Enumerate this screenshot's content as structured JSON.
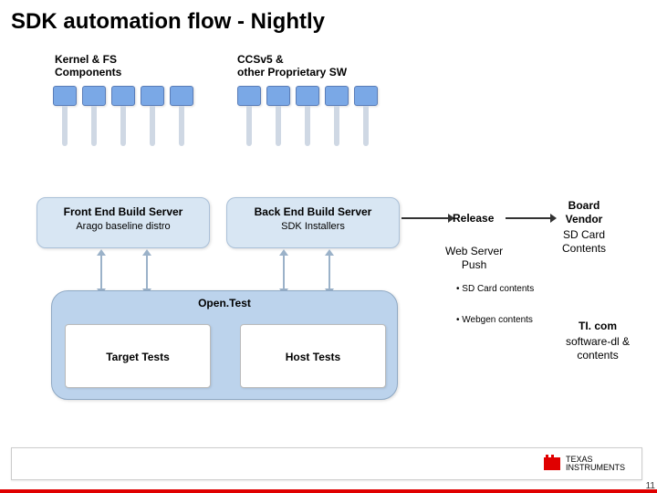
{
  "title": "SDK automation flow - Nightly",
  "labels": {
    "kernel_fs": "Kernel & FS\nComponents",
    "ccsv5": "CCSv5 &\nother Proprietary SW"
  },
  "servers": {
    "front": {
      "h1": "Front End Build Server",
      "h2": "Arago  baseline distro"
    },
    "back": {
      "h1": "Back End Build Server",
      "h2": "SDK Installers"
    }
  },
  "opentest": {
    "label": "Open.Test",
    "target": "Target Tests",
    "host": "Host Tests"
  },
  "right": {
    "release": "Release",
    "webpush": "Web Server\nPush",
    "board_vendor": {
      "h1": "Board\nVendor",
      "h2": "SD Card\nContents"
    },
    "ticom": {
      "h1": "TI. com",
      "h2": "software-dl &\ncontents"
    }
  },
  "bullets": {
    "sd": "SD Card contents",
    "web": "Webgen contents"
  },
  "footer": {
    "brand_l1": "TEXAS",
    "brand_l2": "INSTRUMENTS",
    "slide_no": "11"
  }
}
